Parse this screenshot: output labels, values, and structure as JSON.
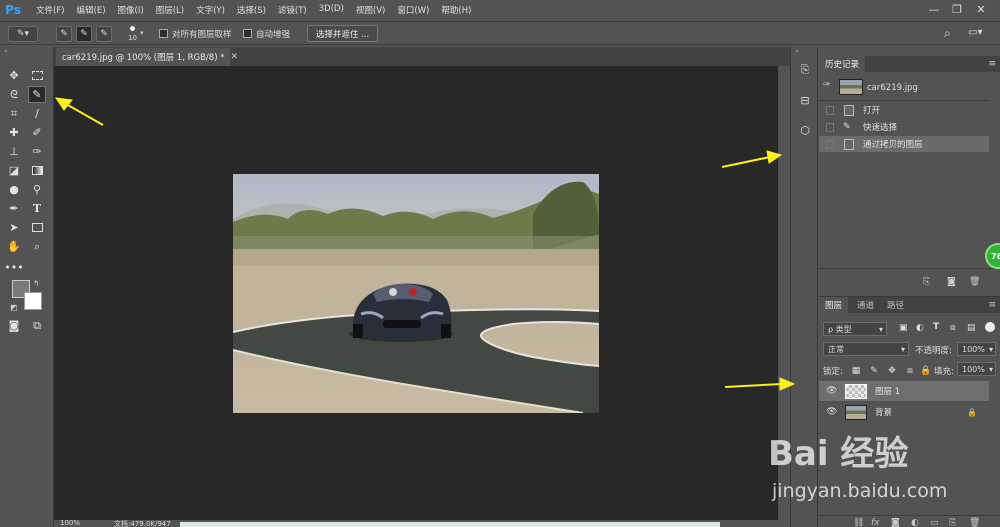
{
  "app": {
    "logo": "Ps"
  },
  "menu": [
    "文件(F)",
    "编辑(E)",
    "图像(I)",
    "图层(L)",
    "文字(Y)",
    "选择(S)",
    "滤镜(T)",
    "3D(D)",
    "视图(V)",
    "窗口(W)",
    "帮助(H)"
  ],
  "options_bar": {
    "brush_size": "10",
    "sample_all_layers_label": "对所有图层取样",
    "auto_enhance_label": "自动增强",
    "select_and_mask_label": "选择并遮住 ..."
  },
  "document": {
    "tab_title": "car6219.jpg @ 100% (图层 1, RGB/8) *",
    "zoom": "100%",
    "doc_size": "文档:479.0K/947"
  },
  "history_panel": {
    "tab": "历史记录",
    "snapshot_name": "car6219.jpg",
    "items": [
      "打开",
      "快速选择",
      "通过拷贝的图层"
    ]
  },
  "layers_panel": {
    "tabs": [
      "图层",
      "通道",
      "路径"
    ],
    "filter_kind": "ρ 类型",
    "blend_mode": "正常",
    "opacity_label": "不透明度:",
    "opacity_value": "100%",
    "lock_label": "锁定:",
    "fill_label": "填充:",
    "fill_value": "100%",
    "layers": [
      {
        "name": "图层 1"
      },
      {
        "name": "背景"
      }
    ]
  },
  "badge": {
    "text": "76"
  },
  "watermark": {
    "main": "Bai 经验",
    "url": "jingyan.baidu.com"
  },
  "colors": {
    "accent_arrow": "#ffef1a",
    "ps_blue": "#31a8ff",
    "badge_green": "#2eb33a"
  }
}
